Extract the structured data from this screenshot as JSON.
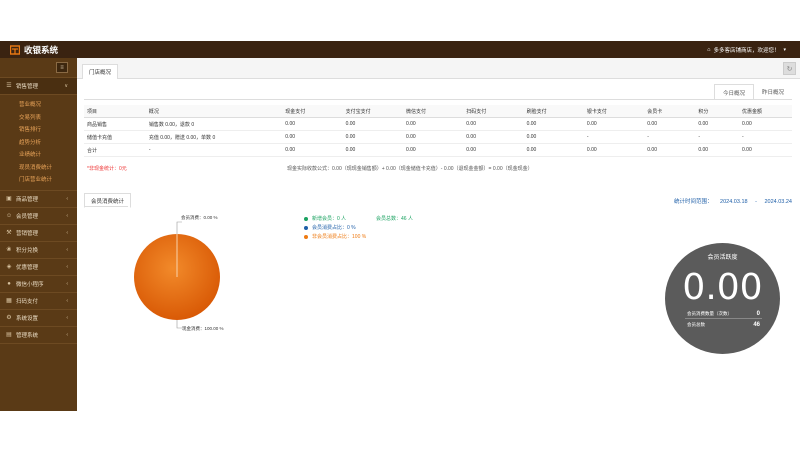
{
  "app": {
    "title": "收银系统"
  },
  "header": {
    "store_greeting": "多多客店铺商店，欢迎您！"
  },
  "sidebar": {
    "groups": [
      {
        "label": "销售管理",
        "icon": "list-icon",
        "open": true,
        "items": [
          "营业概况",
          "交易列表",
          "销售排行",
          "趋势分析",
          "业绩统计",
          "现员消费统计",
          "门店营业统计"
        ]
      },
      {
        "label": "商品管理",
        "icon": "box-icon"
      },
      {
        "label": "会员管理",
        "icon": "user-icon"
      },
      {
        "label": "营销管理",
        "icon": "wrench-icon"
      },
      {
        "label": "积分兑换",
        "icon": "gift-icon"
      },
      {
        "label": "优惠管理",
        "icon": "tag-icon"
      },
      {
        "label": "微信小程序",
        "icon": "wechat-icon"
      },
      {
        "label": "扫码支付",
        "icon": "qrcode-icon"
      },
      {
        "label": "系统设置",
        "icon": "gear-icon"
      },
      {
        "label": "管理系统",
        "icon": "grid-icon"
      }
    ]
  },
  "tabs": {
    "active": "门店概况"
  },
  "period_tabs": {
    "today": "今日概况",
    "yesterday": "昨日概况"
  },
  "table": {
    "headers": [
      "项目",
      "概况",
      "现金支付",
      "支付宝支付",
      "微信支付",
      "扫码支付",
      "刷脸支付",
      "银卡支付",
      "会员卡",
      "积分",
      "优惠金额"
    ],
    "rows": [
      [
        "商品销售",
        "销售数 0.00，退款 0",
        "0.00",
        "0.00",
        "0.00",
        "0.00",
        "0.00",
        "0.00",
        "0.00",
        "0.00",
        "0.00"
      ],
      [
        "储值卡充值",
        "充值 0.00，赠送 0.00，单数 0",
        "0.00",
        "0.00",
        "0.00",
        "0.00",
        "0.00",
        "-",
        "-",
        "-",
        "-"
      ],
      [
        "合计",
        "-",
        "0.00",
        "0.00",
        "0.00",
        "0.00",
        "0.00",
        "0.00",
        "0.00",
        "0.00",
        "0.00"
      ]
    ]
  },
  "notes": {
    "red": "*非现金统计：0元",
    "formula": "现金实际收款公式：0.00（现现金销售额）+ 0.00（现金储值卡充值）- 0.00（退现金金额）= 0.00（现金现金）"
  },
  "section": {
    "tab": "会员消费统计",
    "date_label": "统计时间范围：",
    "date_from": "2024.03.18",
    "date_to": "2024.03.24"
  },
  "legend": {
    "items": [
      {
        "label": "新增会员：0 人",
        "color": "#1aa260"
      },
      {
        "label": "会员总数：46 人",
        "color": "#1aa260"
      },
      {
        "label": "会员消费占比：0 %",
        "color": "#1f5fa8"
      },
      {
        "label": "非会员消费占比：100 %",
        "color": "#ee7a12"
      }
    ]
  },
  "chart_data": {
    "type": "pie",
    "slices": [
      {
        "label": "会员消费：0.00 %",
        "value": 0
      },
      {
        "label": "现金消费：100.00 %",
        "value": 100
      }
    ],
    "colors": [
      "#1f5fa8",
      "#ee7a12"
    ]
  },
  "gauge": {
    "title": "会员活跃度",
    "value": "0.00",
    "rows": [
      {
        "label": "会员消费数量（次数）",
        "value": "0"
      },
      {
        "label": "会员总数",
        "value": "46"
      }
    ]
  }
}
